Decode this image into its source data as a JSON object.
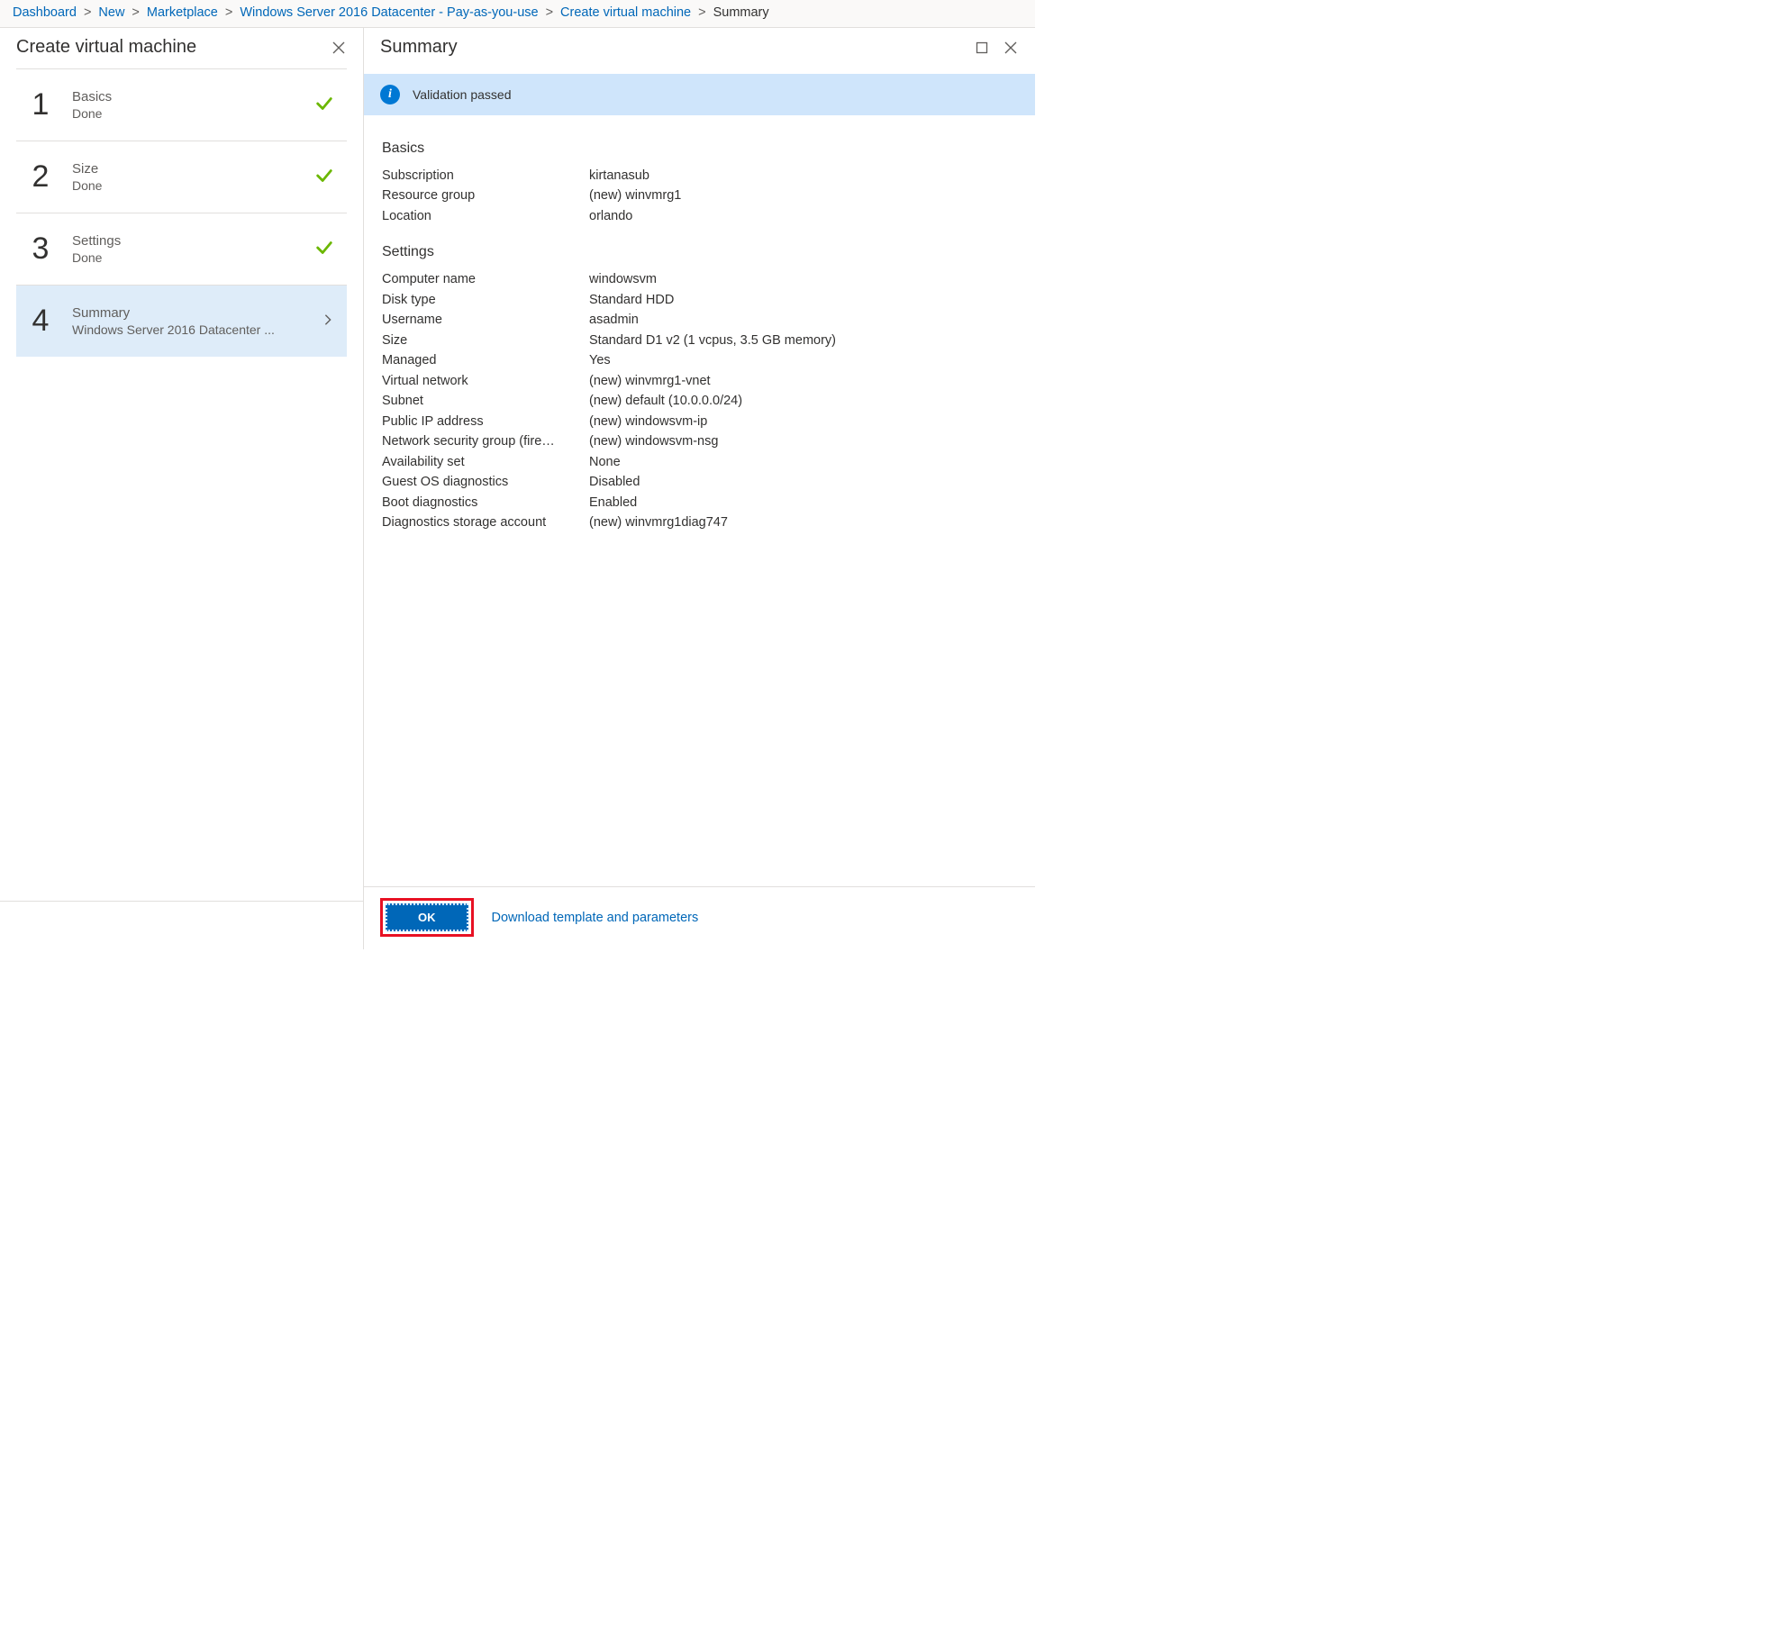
{
  "breadcrumb": {
    "items": [
      {
        "label": "Dashboard",
        "link": true
      },
      {
        "label": "New",
        "link": true
      },
      {
        "label": "Marketplace",
        "link": true
      },
      {
        "label": "Windows Server 2016 Datacenter - Pay-as-you-use",
        "link": true
      },
      {
        "label": "Create virtual machine",
        "link": true
      },
      {
        "label": "Summary",
        "link": false
      }
    ]
  },
  "left": {
    "title": "Create virtual machine",
    "steps": [
      {
        "num": "1",
        "title": "Basics",
        "sub": "Done",
        "done": true,
        "active": false
      },
      {
        "num": "2",
        "title": "Size",
        "sub": "Done",
        "done": true,
        "active": false
      },
      {
        "num": "3",
        "title": "Settings",
        "sub": "Done",
        "done": true,
        "active": false
      },
      {
        "num": "4",
        "title": "Summary",
        "sub": "Windows Server 2016 Datacenter ...",
        "done": false,
        "active": true
      }
    ]
  },
  "right": {
    "title": "Summary",
    "validation_text": "Validation passed",
    "sections": [
      {
        "title": "Basics",
        "rows": [
          {
            "k": "Subscription",
            "v": "kirtanasub"
          },
          {
            "k": "Resource group",
            "v": "(new) winvmrg1"
          },
          {
            "k": "Location",
            "v": "orlando"
          }
        ]
      },
      {
        "title": "Settings",
        "rows": [
          {
            "k": "Computer name",
            "v": "windowsvm"
          },
          {
            "k": "Disk type",
            "v": "Standard HDD"
          },
          {
            "k": "Username",
            "v": "asadmin"
          },
          {
            "k": "Size",
            "v": "Standard D1 v2 (1 vcpus, 3.5 GB memory)"
          },
          {
            "k": "Managed",
            "v": "Yes"
          },
          {
            "k": "Virtual network",
            "v": "(new) winvmrg1-vnet"
          },
          {
            "k": "Subnet",
            "v": "(new) default (10.0.0.0/24)"
          },
          {
            "k": "Public IP address",
            "v": "(new) windowsvm-ip"
          },
          {
            "k": "Network security group (fire…",
            "v": "(new) windowsvm-nsg"
          },
          {
            "k": "Availability set",
            "v": "None"
          },
          {
            "k": "Guest OS diagnostics",
            "v": "Disabled"
          },
          {
            "k": "Boot diagnostics",
            "v": "Enabled"
          },
          {
            "k": "Diagnostics storage account",
            "v": "(new) winvmrg1diag747"
          }
        ]
      }
    ],
    "ok_label": "OK",
    "download_label": "Download template and parameters"
  }
}
